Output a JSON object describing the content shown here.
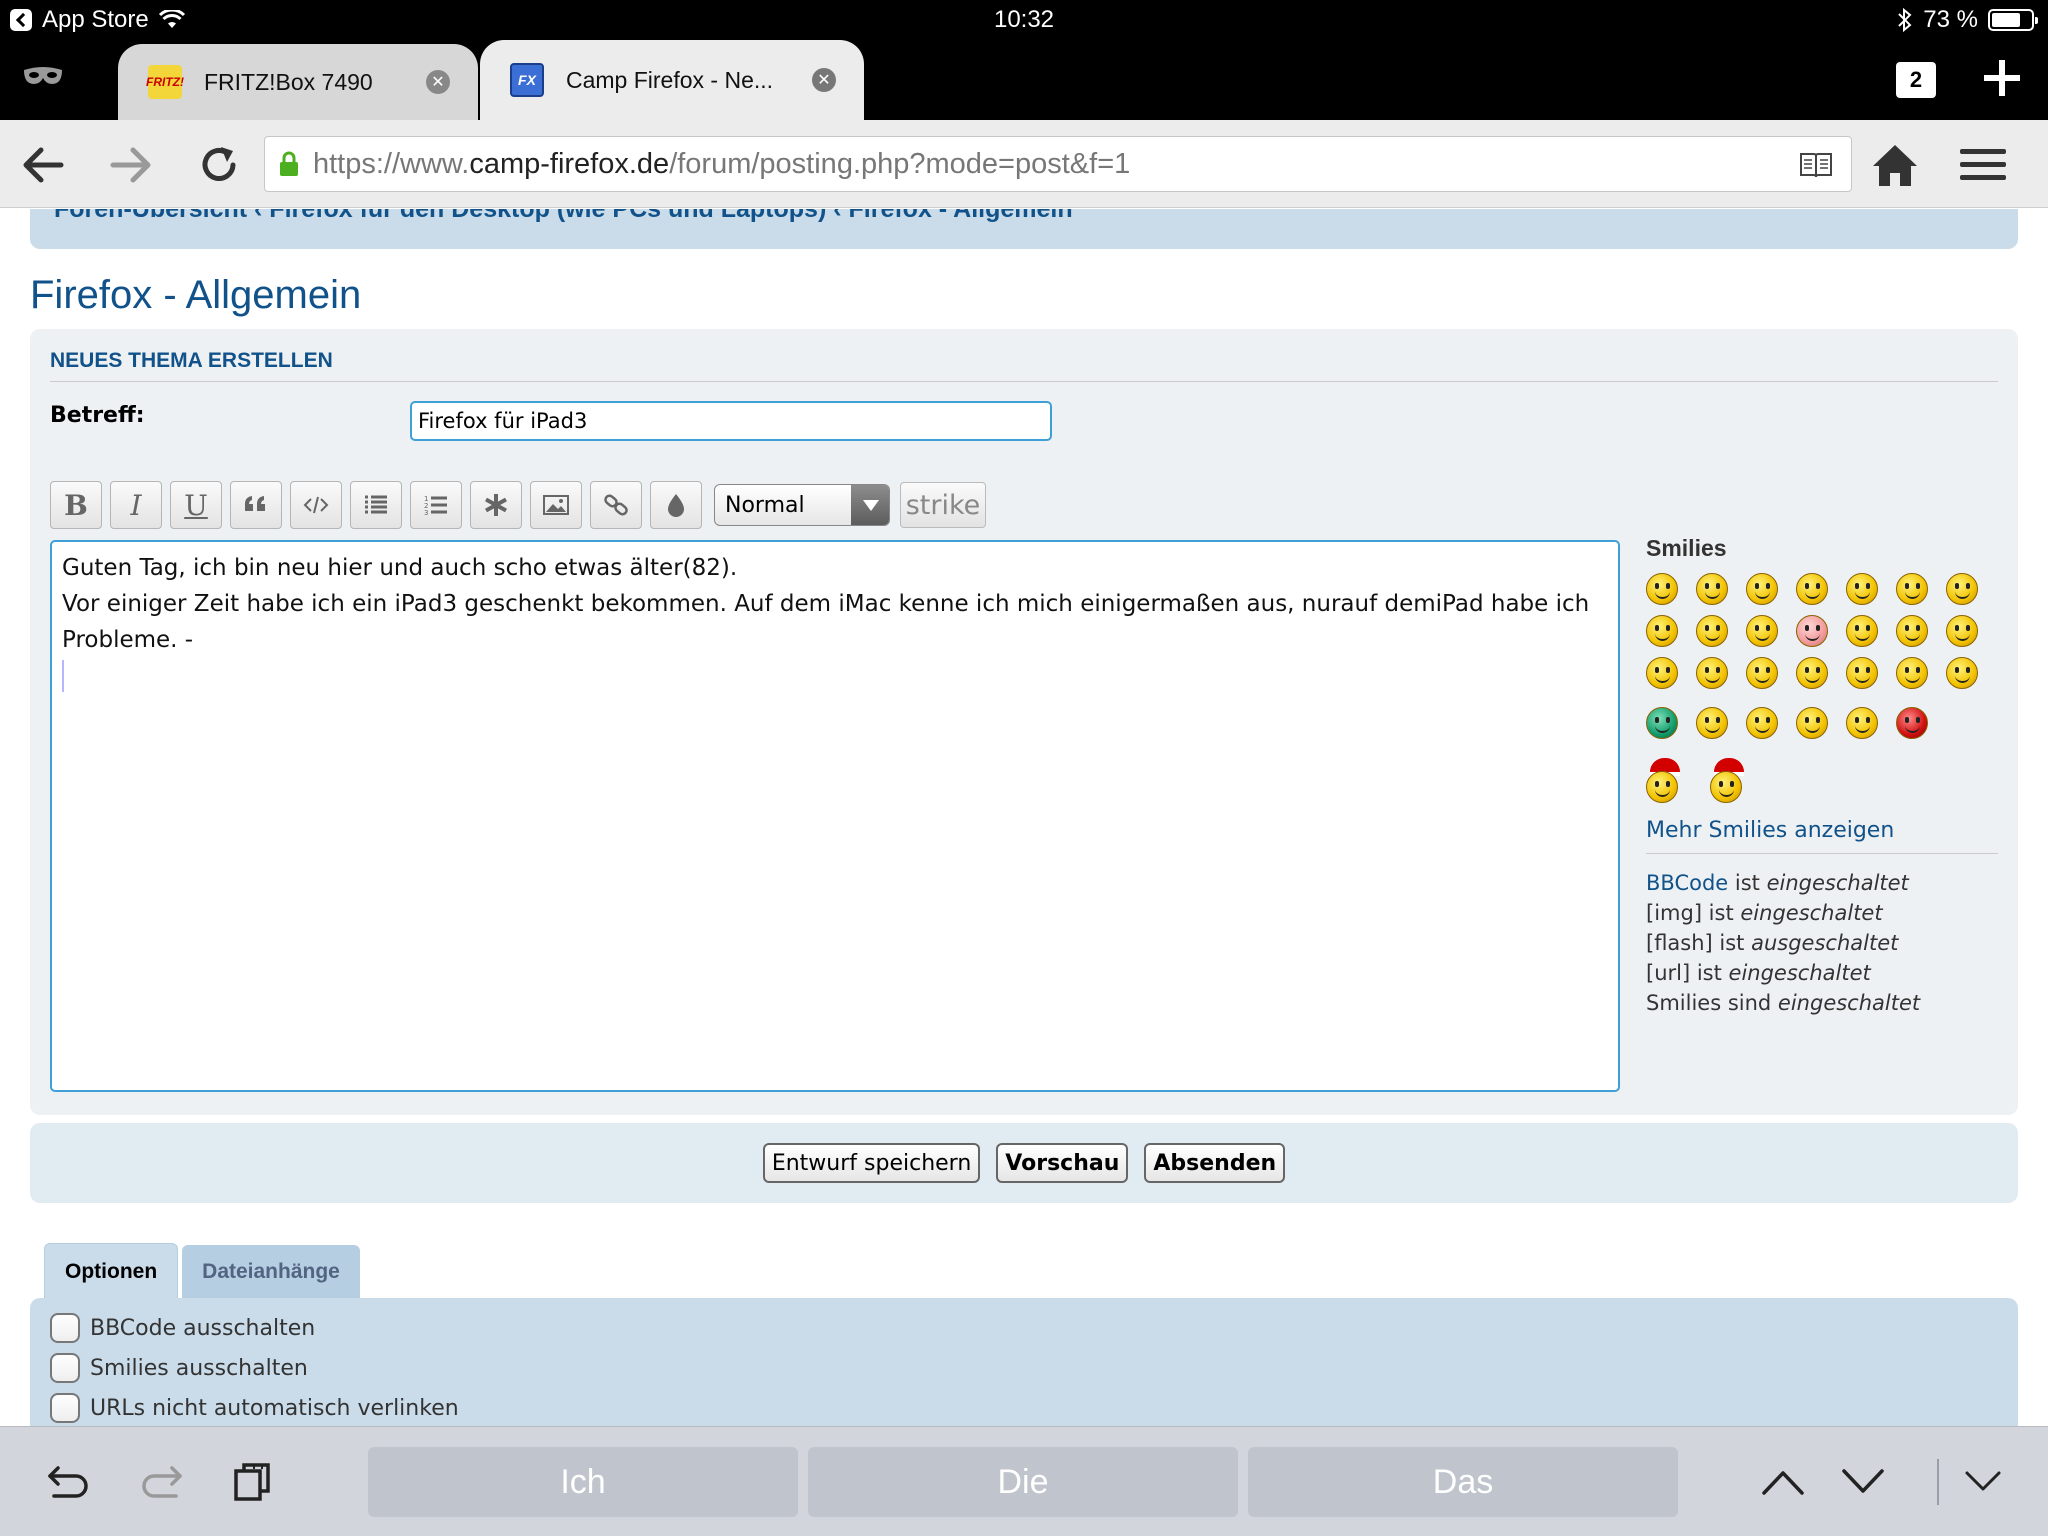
{
  "status_bar": {
    "back_app": "App Store",
    "time": "10:32",
    "battery": "73 %",
    "battery_level": 0.73
  },
  "tabs": [
    {
      "title": "FRITZ!Box 7490",
      "favicon": "FRITZ!"
    },
    {
      "title": "Camp Firefox - Ne...",
      "favicon": "FX"
    }
  ],
  "tab_count": "2",
  "url": {
    "prefix": "https://www.",
    "domain": "camp-firefox.de",
    "path": "/forum/posting.php?mode=post&f=1"
  },
  "page": {
    "breadcrumb": "Foren-Übersicht ‹ Firefox für den Desktop (wie PCs und Laptops) ‹ Firefox - Allgemein",
    "forum_title": "Firefox - Allgemein",
    "panel_heading": "NEUES THEMA ERSTELLEN",
    "subject_label": "Betreff:",
    "subject_value": "Firefox für iPad3",
    "toolbar": {
      "bold": "B",
      "italic": "I",
      "underline": "U",
      "font_size": "Normal",
      "strike": "strike"
    },
    "message_lines": [
      "Guten Tag, ich bin neu hier und auch scho etwas älter(82).",
      "Vor einiger Zeit habe ich ein iPad3 geschenkt bekommen. Auf dem iMac kenne ich mich einigermaßen aus, nurauf demiPad habe ich Probleme. -"
    ],
    "smilies": {
      "title": "Smilies",
      "more_link": "Mehr Smilies anzeigen"
    },
    "bbcode_status": {
      "bbcode_link": "BBCode",
      "bbcode_text": " ist ",
      "bbcode_state": "eingeschaltet",
      "img_text": "[img] ist ",
      "img_state": "eingeschaltet",
      "flash_text": "[flash] ist ",
      "flash_state": "ausgeschaltet",
      "url_text": "[url] ist ",
      "url_state": "eingeschaltet",
      "smilies_text": "Smilies sind ",
      "smilies_state": "eingeschaltet"
    },
    "buttons": {
      "save_draft": "Entwurf speichern",
      "preview": "Vorschau",
      "submit": "Absenden"
    },
    "option_tabs": [
      "Optionen",
      "Dateianhänge"
    ],
    "options": [
      "BBCode ausschalten",
      "Smilies ausschalten",
      "URLs nicht automatisch verlinken"
    ]
  },
  "keyboard_bar": {
    "suggestions": [
      "Ich",
      "Die",
      "Das"
    ]
  },
  "colors": {
    "forum_blue": "#105289",
    "panel_bg": "#eef1f3",
    "header_bg": "#cadcea",
    "focus_border": "#3fa0d8"
  }
}
